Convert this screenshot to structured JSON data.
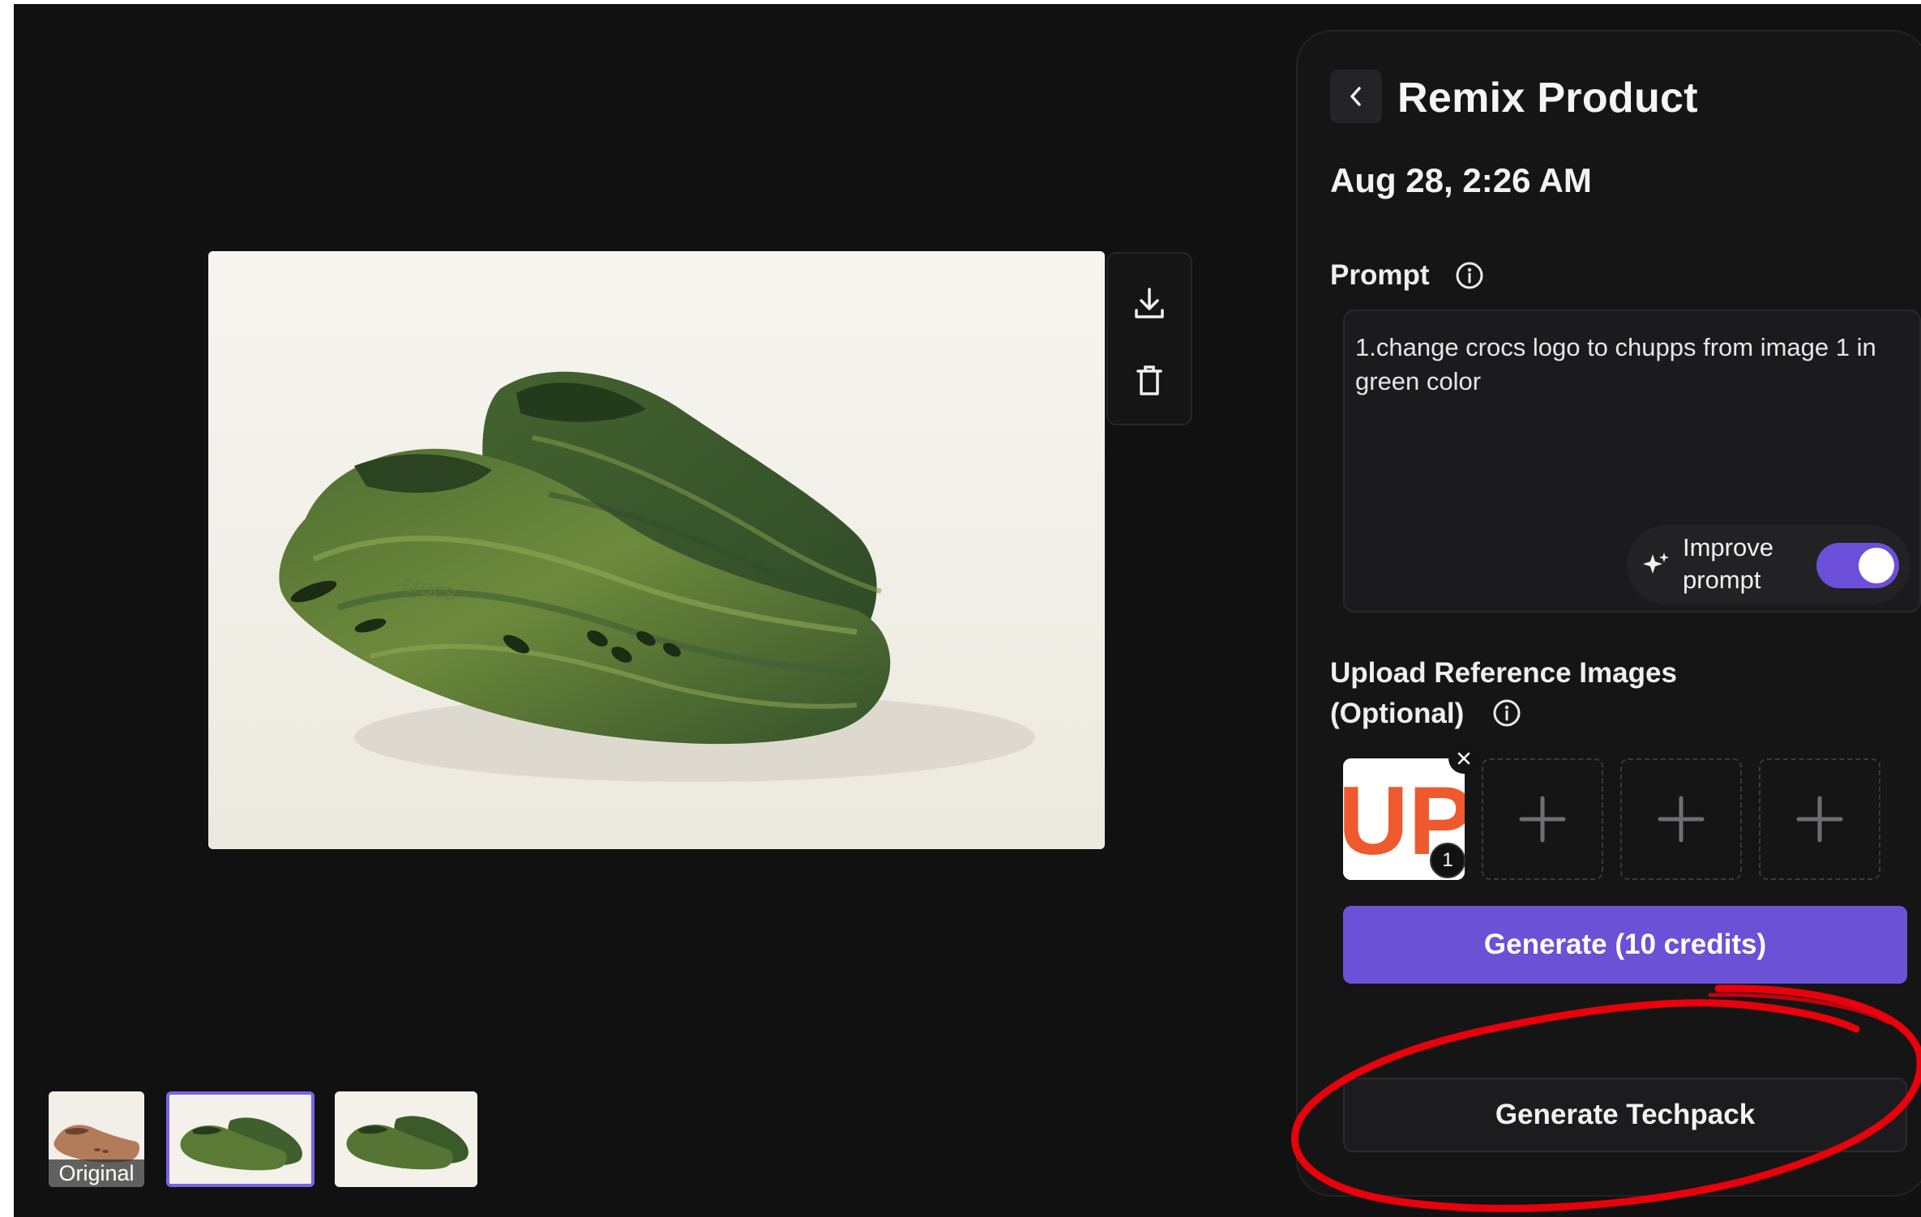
{
  "panel": {
    "title": "Remix Product",
    "date": "Aug 28, 2:26 AM",
    "prompt_label": "Prompt",
    "prompt_value": "1.change crocs logo to chupps from image 1 in green color",
    "improve_line1": "Improve",
    "improve_line2": "prompt",
    "improve_enabled": true,
    "upload_label_line1": "Upload Reference Images",
    "upload_label_line2": "(Optional)",
    "reference": {
      "filled_text": "UP",
      "badge": "1",
      "empty_slots": 3
    },
    "generate_label": "Generate (10 credits)",
    "techpack_label": "Generate Techpack"
  },
  "preview": {
    "logo_text": "crocs"
  },
  "thumbnails": [
    {
      "label": "Original",
      "color": "brown",
      "selected": false
    },
    {
      "label": "",
      "color": "green",
      "selected": true
    },
    {
      "label": "",
      "color": "green",
      "selected": false
    }
  ],
  "colors": {
    "accent": "#6a51d6",
    "toggle_on": "#6b4fd8",
    "annotation": "#e8000b",
    "background": "#111112",
    "panel": "#151516"
  },
  "icons": {
    "back": "chevron-left-icon",
    "download": "download-icon",
    "delete": "trash-icon",
    "info": "info-icon",
    "sparkle": "sparkle-icon",
    "add": "plus-icon",
    "close": "close-icon"
  }
}
